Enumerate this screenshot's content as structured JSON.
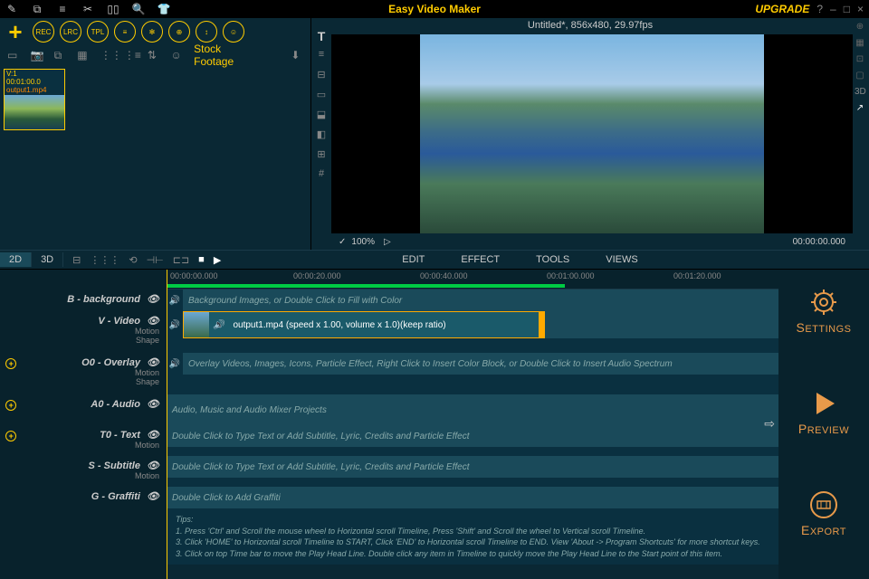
{
  "app": {
    "title": "Easy Video Maker",
    "upgrade": "UPGRADE"
  },
  "project": {
    "status": "Untitled*, 856x480, 29.97fps"
  },
  "toolbar": {
    "circ": [
      "REC",
      "LRC",
      "TPL",
      "≡",
      "✻",
      "⊕",
      "↕",
      "☺"
    ],
    "stock": "Stock Footage"
  },
  "media": {
    "thumb": {
      "id": "V:1",
      "duration": "00:01:00.0",
      "name": "output1.mp4"
    }
  },
  "preview": {
    "zoom_out": "✓",
    "zoom": "100%",
    "play": "▷",
    "timecode": "00:00:00.000"
  },
  "dims": {
    "d2": "2D",
    "d3": "3D"
  },
  "menus": {
    "edit": "EDIT",
    "effect": "EFFECT",
    "tools": "TOOLS",
    "views": "VIEWS"
  },
  "ruler": [
    "00:00:00.000",
    "00:00:20.000",
    "00:00:40.000",
    "00:01:00.000",
    "00:01:20.000"
  ],
  "tracks": {
    "bg": {
      "label": "B - background",
      "hint": "Background Images, or Double Click to Fill with Color"
    },
    "video": {
      "label": "V - Video",
      "sub1": "Motion",
      "sub2": "Shape",
      "clip": "output1.mp4  (speed x 1.00, volume x 1.0)(keep ratio)"
    },
    "overlay": {
      "label": "O0 - Overlay",
      "sub1": "Motion",
      "sub2": "Shape",
      "hint": "Overlay Videos, Images, Icons, Particle Effect, Right Click to Insert Color Block, or Double Click to Insert Audio Spectrum"
    },
    "audio": {
      "label": "A0 - Audio",
      "hint": "Audio, Music and Audio Mixer Projects"
    },
    "text": {
      "label": "T0 - Text",
      "sub1": "Motion",
      "hint": "Double Click to Type Text or Add Subtitle, Lyric, Credits and Particle Effect"
    },
    "subtitle": {
      "label": "S - Subtitle",
      "sub1": "Motion",
      "hint": "Double Click to Type Text or Add Subtitle, Lyric, Credits and Particle Effect"
    },
    "graffiti": {
      "label": "G - Graffiti",
      "hint": "Double Click to Add Graffiti"
    }
  },
  "tips": {
    "title": "Tips:",
    "l1": "1. Press 'Ctrl' and Scroll the mouse wheel to Horizontal scroll Timeline, Press 'Shift' and Scroll the wheel to Vertical scroll Timeline.",
    "l2": "3. Click 'HOME' to Horizontal scroll Timeline to START, Click 'END' to Horizontal scroll Timeline to END. View 'About -> Program Shortcuts' for more shortcut keys.",
    "l3": "3. Click on top Time bar to move the Play Head Line. Double click any item in Timeline to quickly move the Play Head Line to the Start point of this item."
  },
  "right": {
    "settings": "SETTINGS",
    "preview": "PREVIEW",
    "export": "EXPORT"
  }
}
